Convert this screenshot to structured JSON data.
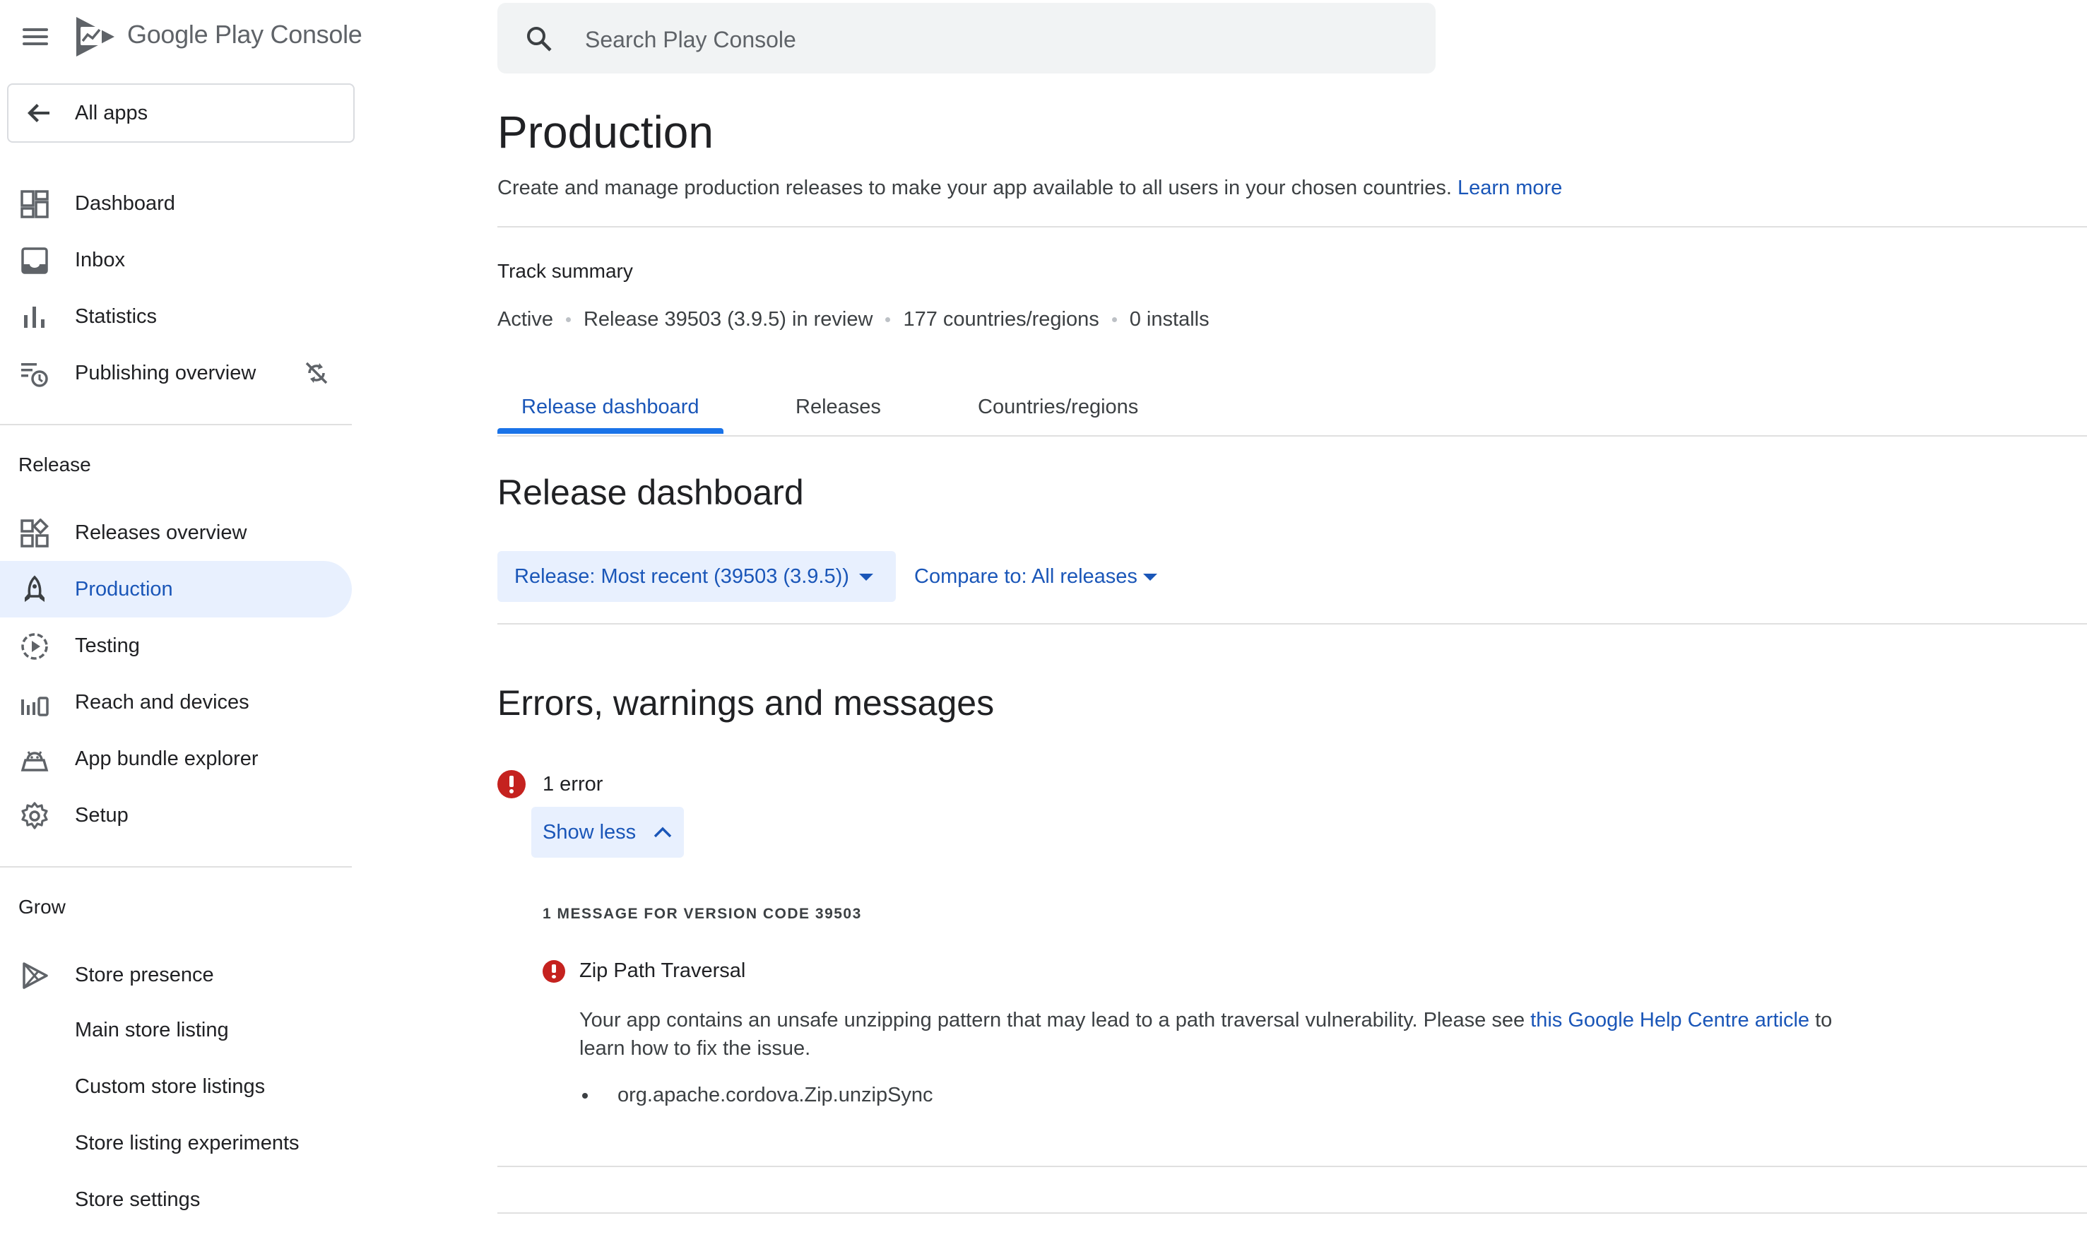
{
  "app": {
    "logo_brand": "Google Play",
    "logo_product": "Console"
  },
  "sidebar": {
    "all_apps_label": "All apps",
    "top_items": [
      {
        "label": "Dashboard",
        "icon": "dashboard-icon"
      },
      {
        "label": "Inbox",
        "icon": "inbox-icon"
      },
      {
        "label": "Statistics",
        "icon": "bar-chart-icon"
      },
      {
        "label": "Publishing overview",
        "icon": "publishing-overview-icon",
        "trail_icon": "sync-off-icon"
      }
    ],
    "release_section": "Release",
    "release_items": [
      {
        "label": "Releases overview",
        "icon": "releases-overview-icon"
      },
      {
        "label": "Production",
        "icon": "production-icon",
        "active": true
      },
      {
        "label": "Testing",
        "icon": "testing-icon"
      },
      {
        "label": "Reach and devices",
        "icon": "reach-devices-icon"
      },
      {
        "label": "App bundle explorer",
        "icon": "android-icon"
      },
      {
        "label": "Setup",
        "icon": "gear-icon"
      }
    ],
    "grow_section": "Grow",
    "grow_items": [
      {
        "label": "Store presence",
        "icon": "play-store-icon"
      }
    ],
    "grow_subitems": [
      {
        "label": "Main store listing"
      },
      {
        "label": "Custom store listings"
      },
      {
        "label": "Store listing experiments"
      },
      {
        "label": "Store settings"
      }
    ]
  },
  "search": {
    "placeholder": "Search Play Console"
  },
  "page": {
    "title": "Production",
    "description": "Create and manage production releases to make your app available to all users in your chosen countries.",
    "learn_more": "Learn more"
  },
  "track_summary": {
    "title": "Track summary",
    "status": "Active",
    "release": "Release 39503 (3.9.5) in review",
    "countries": "177 countries/regions",
    "installs": "0 installs"
  },
  "tabs": [
    {
      "label": "Release dashboard",
      "active": true
    },
    {
      "label": "Releases"
    },
    {
      "label": "Countries/regions"
    }
  ],
  "release_dashboard": {
    "title": "Release dashboard",
    "release_filter": "Release: Most recent (39503 (3.9.5))",
    "compare_filter": "Compare to: All releases"
  },
  "errors": {
    "title": "Errors, warnings and messages",
    "count_label": "1 error",
    "show_less": "Show less",
    "message_header": "1 MESSAGE FOR VERSION CODE 39503",
    "message_title": "Zip Path Traversal",
    "message_body_before": "Your app contains an unsafe unzipping pattern that may lead to a path traversal vulnerability. Please see ",
    "message_link": "this Google Help Centre article",
    "message_body_after": " to learn how to fix the issue.",
    "bullet": "org.apache.cordova.Zip.unzipSync"
  },
  "colors": {
    "accent": "#1a56b8",
    "active_bg": "#e8f0fe",
    "error": "#c5221f"
  }
}
